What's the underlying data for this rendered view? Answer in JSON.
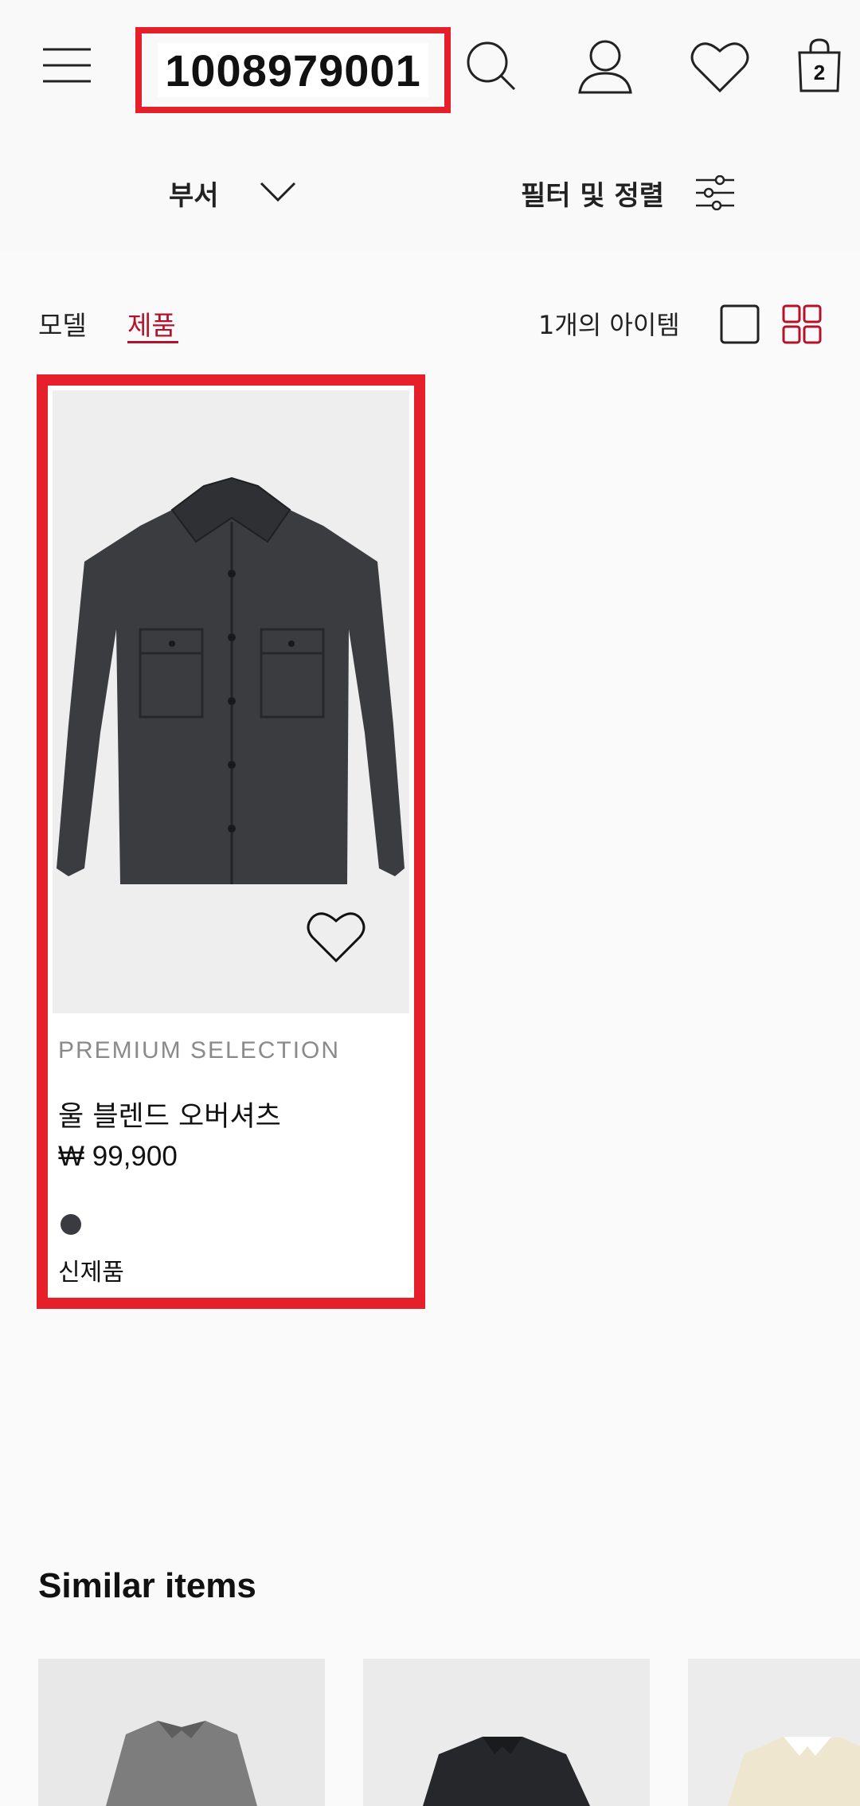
{
  "header": {
    "search_value": "1008979001",
    "icons": [
      "menu-icon",
      "search-icon",
      "account-icon",
      "favorites-icon",
      "bag-icon"
    ],
    "bag_count": "2"
  },
  "subbar": {
    "department_label": "부서",
    "filter_label": "필터 및 정렬"
  },
  "tabs": [
    {
      "label": "모델",
      "active": false
    },
    {
      "label": "제품",
      "active": true
    }
  ],
  "results": {
    "count_label": "1개의 아이템",
    "views": [
      "single-view",
      "grid-view"
    ]
  },
  "product": {
    "brand_line": "PREMIUM SELECTION",
    "name": "울 블렌드 오버셔츠",
    "price": "₩ 99,900",
    "color": "#3a3b40",
    "badge": "신제품"
  },
  "similar": {
    "title": "Similar items"
  },
  "colors": {
    "accent": "#b4122a",
    "highlight": "#e5202b"
  }
}
